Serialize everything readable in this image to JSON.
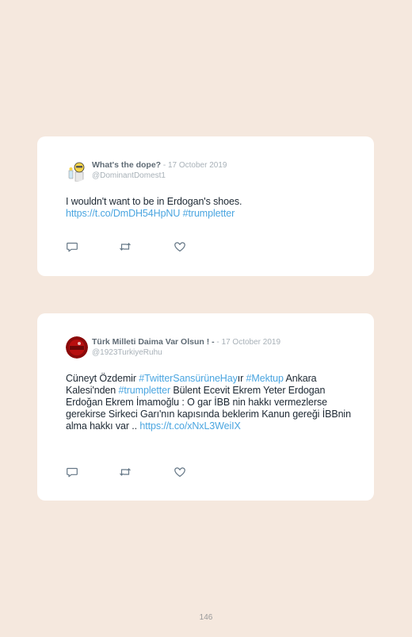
{
  "tweets": [
    {
      "name": "What's the dope?",
      "date": " - 17 October 2019",
      "handle": "@DominantDomest1",
      "text_line1": "I wouldn't want to be in Erdogan's shoes.",
      "link_url": "https://t.co/DmDH54HpNU",
      "link_hashtag": " #trumpletter",
      "avatar_icon": "cartoon-scientist-avatar"
    },
    {
      "name": "Türk Milleti Daima Var Olsun ! -",
      "date": " - 17 October 2019",
      "handle": "@1923TurkiyeRuhu",
      "avatar_icon": "red-flag-avatar",
      "seg1": "Cüneyt Özdemir ",
      "tag1": "#TwitterSansürüneHay",
      "seg2": "ır ",
      "tag2": "#Mektup",
      "seg3": " Ankara Kalesi'nden ",
      "tag3": "#trumpletter",
      "seg4": " Bülent Ecevit Ekrem Yeter Erdogan Erdoğan Ekrem İmamoğlu : O gar İBB nin hakkı vermezlerse gerekirse Sirkeci Garı'nın kapısında beklerim Kanun gereği İBBnin alma hakkı var .. ",
      "url": "https://t.co/xNxL3WeiIX"
    }
  ],
  "icons": {
    "reply": "reply-icon",
    "retweet": "retweet-icon",
    "like": "heart-icon"
  },
  "page_number": "146"
}
